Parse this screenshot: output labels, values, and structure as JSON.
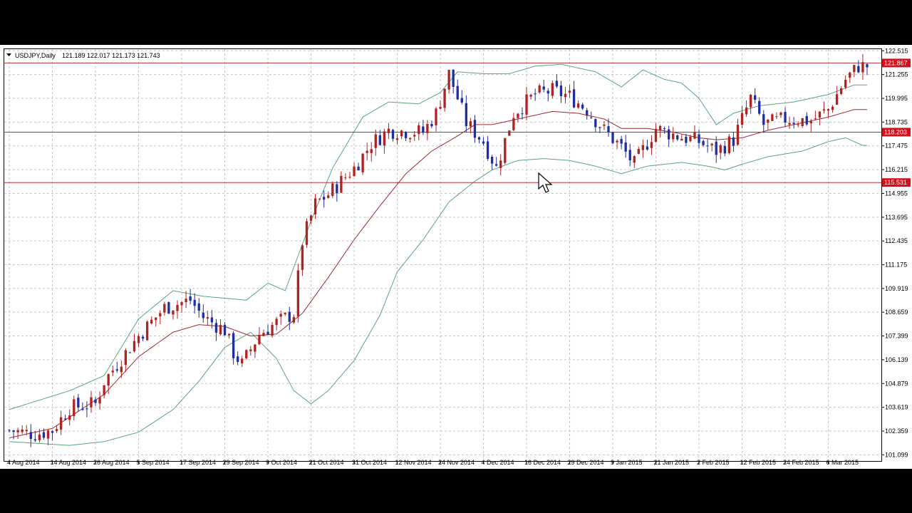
{
  "header": {
    "symbol": "USDJPY,Daily",
    "ohlc": "121.189 122.017 121.173 121.743"
  },
  "colors": {
    "up_candle": "#b22222",
    "down_candle": "#1f2fa0",
    "bands": "#5aa57a",
    "ma": "#a0282d",
    "hline": "#b2323c",
    "price_tag": "#d0101a",
    "grid": "#c6c6c6"
  },
  "hlines": [
    {
      "value": 121.867,
      "label": "121.867"
    },
    {
      "value": 118.203,
      "label": "118.203"
    },
    {
      "value": 115.531,
      "label": "115.531"
    }
  ],
  "chart_data": {
    "type": "candlestick",
    "title": "USDJPY,Daily",
    "ylim": [
      101.0,
      122.6
    ],
    "y_ticks": [
      "122.515",
      "121.255",
      "119.995",
      "118.735",
      "117.475",
      "116.215",
      "114.955",
      "113.695",
      "112.435",
      "111.175",
      "109.919",
      "108.659",
      "107.399",
      "106.139",
      "104.879",
      "103.619",
      "102.359",
      "101.099"
    ],
    "x_tick_labels": [
      "4 Aug 2014",
      "14 Aug 2014",
      "26 Aug 2014",
      "5 Sep 2014",
      "17 Sep 2014",
      "29 Sep 2014",
      "9 Oct 2014",
      "21 Oct 2014",
      "31 Oct 2014",
      "12 Nov 2014",
      "24 Nov 2014",
      "4 Dec 2014",
      "16 Dec 2014",
      "29 Dec 2014",
      "9 Jan 2015",
      "21 Jan 2015",
      "2 Feb 2015",
      "12 Feb 2015",
      "24 Feb 2015",
      "6 Mar 2015"
    ],
    "grid": true,
    "anchors": [
      [
        0,
        102.4
      ],
      [
        6,
        102.2
      ],
      [
        10,
        102.4
      ],
      [
        14,
        103.6
      ],
      [
        20,
        103.8
      ],
      [
        22,
        105.0
      ],
      [
        30,
        107.4
      ],
      [
        36,
        108.9
      ],
      [
        42,
        109.3
      ],
      [
        45,
        108.4
      ],
      [
        50,
        107.7
      ],
      [
        52,
        106.5
      ],
      [
        54,
        105.9
      ],
      [
        58,
        107.5
      ],
      [
        62,
        108.1
      ],
      [
        66,
        108.6
      ],
      [
        68,
        112.4
      ],
      [
        71,
        114.4
      ],
      [
        74,
        114.9
      ],
      [
        80,
        116.3
      ],
      [
        84,
        117.6
      ],
      [
        88,
        118.3
      ],
      [
        96,
        118.2
      ],
      [
        99,
        119.2
      ],
      [
        102,
        121.3
      ],
      [
        106,
        118.7
      ],
      [
        110,
        117.7
      ],
      [
        113,
        116.3
      ],
      [
        117,
        119.2
      ],
      [
        122,
        120.2
      ],
      [
        126,
        120.4
      ],
      [
        130,
        120.1
      ],
      [
        134,
        119.4
      ],
      [
        138,
        118.3
      ],
      [
        142,
        117.4
      ],
      [
        145,
        116.5
      ],
      [
        150,
        118.4
      ],
      [
        155,
        118.0
      ],
      [
        160,
        117.7
      ],
      [
        164,
        117.2
      ],
      [
        168,
        117.8
      ],
      [
        172,
        120.0
      ],
      [
        175,
        118.6
      ],
      [
        180,
        118.9
      ],
      [
        186,
        118.8
      ],
      [
        190,
        119.4
      ],
      [
        194,
        121.0
      ],
      [
        197,
        121.7
      ]
    ],
    "bb_upper": [
      [
        0,
        103.5
      ],
      [
        14,
        104.5
      ],
      [
        22,
        105.3
      ],
      [
        30,
        108.3
      ],
      [
        38,
        109.8
      ],
      [
        45,
        109.5
      ],
      [
        55,
        109.3
      ],
      [
        60,
        110.2
      ],
      [
        64,
        109.8
      ],
      [
        70,
        113.5
      ],
      [
        75,
        116.3
      ],
      [
        82,
        119.0
      ],
      [
        88,
        119.8
      ],
      [
        95,
        119.7
      ],
      [
        100,
        120.3
      ],
      [
        104,
        121.4
      ],
      [
        110,
        121.3
      ],
      [
        116,
        121.3
      ],
      [
        122,
        121.7
      ],
      [
        128,
        121.8
      ],
      [
        136,
        121.4
      ],
      [
        142,
        120.6
      ],
      [
        147,
        121.5
      ],
      [
        152,
        121.0
      ],
      [
        156,
        120.8
      ],
      [
        160,
        120.0
      ],
      [
        164,
        118.6
      ],
      [
        168,
        119.2
      ],
      [
        174,
        119.6
      ],
      [
        182,
        119.8
      ],
      [
        190,
        120.2
      ],
      [
        196,
        120.7
      ]
    ],
    "bb_lower": [
      [
        0,
        101.8
      ],
      [
        14,
        101.6
      ],
      [
        22,
        101.8
      ],
      [
        30,
        102.3
      ],
      [
        38,
        103.5
      ],
      [
        44,
        105.0
      ],
      [
        50,
        106.8
      ],
      [
        56,
        107.6
      ],
      [
        62,
        106.2
      ],
      [
        66,
        104.5
      ],
      [
        70,
        103.8
      ],
      [
        74,
        104.5
      ],
      [
        80,
        106.1
      ],
      [
        86,
        108.5
      ],
      [
        90,
        110.8
      ],
      [
        96,
        112.5
      ],
      [
        102,
        114.5
      ],
      [
        108,
        115.6
      ],
      [
        112,
        116.2
      ],
      [
        118,
        116.7
      ],
      [
        124,
        116.8
      ],
      [
        130,
        116.7
      ],
      [
        136,
        116.4
      ],
      [
        142,
        116.0
      ],
      [
        148,
        116.4
      ],
      [
        156,
        116.6
      ],
      [
        162,
        116.4
      ],
      [
        166,
        116.2
      ],
      [
        170,
        116.5
      ],
      [
        176,
        116.9
      ],
      [
        184,
        117.2
      ],
      [
        190,
        117.7
      ],
      [
        194,
        117.9
      ],
      [
        198,
        117.5
      ]
    ],
    "ma": [
      [
        0,
        102.0
      ],
      [
        10,
        102.5
      ],
      [
        22,
        104.3
      ],
      [
        30,
        106.3
      ],
      [
        38,
        107.6
      ],
      [
        44,
        108.0
      ],
      [
        50,
        107.9
      ],
      [
        56,
        107.4
      ],
      [
        62,
        107.5
      ],
      [
        68,
        108.6
      ],
      [
        74,
        110.5
      ],
      [
        80,
        112.5
      ],
      [
        86,
        114.3
      ],
      [
        92,
        116.0
      ],
      [
        98,
        117.2
      ],
      [
        104,
        118.0
      ],
      [
        108,
        118.6
      ],
      [
        112,
        118.6
      ],
      [
        116,
        118.8
      ],
      [
        120,
        119.0
      ],
      [
        126,
        119.3
      ],
      [
        132,
        119.2
      ],
      [
        138,
        118.9
      ],
      [
        142,
        118.4
      ],
      [
        148,
        118.4
      ],
      [
        154,
        118.2
      ],
      [
        160,
        117.9
      ],
      [
        164,
        117.8
      ],
      [
        170,
        117.9
      ],
      [
        176,
        118.3
      ],
      [
        182,
        118.6
      ],
      [
        190,
        119.0
      ],
      [
        196,
        119.4
      ]
    ]
  }
}
